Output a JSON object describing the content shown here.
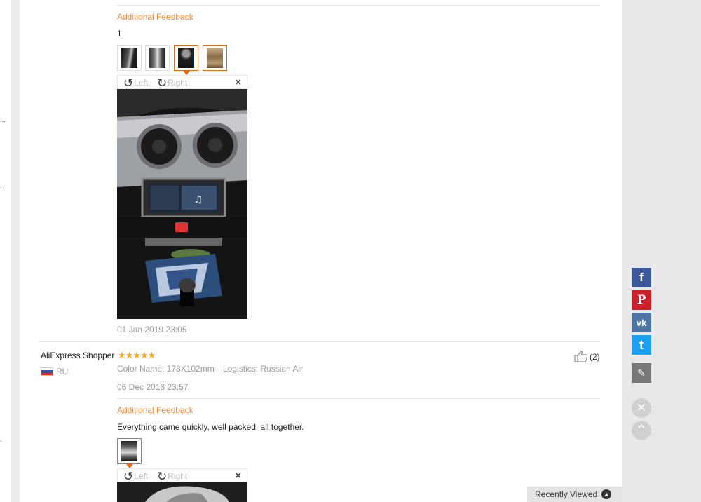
{
  "reviews": [
    {
      "feedback_label": "Additional Feedback",
      "feedback_text": "1",
      "viewer": {
        "left_label": "Left",
        "right_label": "Right",
        "close": "×"
      },
      "date": "01 Jan 2019 23:05"
    },
    {
      "buyer": "AliExpress Shopper",
      "stars": "★★★★★",
      "country": "RU",
      "helpful_count": "(2)",
      "color_name": "Color Name: 178X102mm",
      "logistics": "Logistics: Russian Air",
      "date": "06 Dec 2018 23:57",
      "feedback_label": "Additional Feedback",
      "feedback_text": "Everything came quickly, well packed, all together.",
      "viewer": {
        "left_label": "Left",
        "right_label": "Right",
        "close": "×"
      }
    }
  ],
  "gutter": {
    "dot1": "...",
    "dot2": ".",
    "dot3": "."
  },
  "sidebar": {
    "facebook": "f",
    "pinterest": "P",
    "vk": "vk",
    "twitter": "t",
    "edit": "✎",
    "close": "✕",
    "up": "⌃"
  },
  "recently_viewed": {
    "label": "Recently Viewed",
    "arrow": "▲"
  },
  "colors": {
    "accent_orange": "#f0883a",
    "active_border": "#e06b1c",
    "star": "#f5a623",
    "facebook": "#3b5998",
    "pinterest": "#cb2027",
    "vk": "#4c75a3",
    "twitter": "#1da1f2",
    "edit": "#777777"
  }
}
